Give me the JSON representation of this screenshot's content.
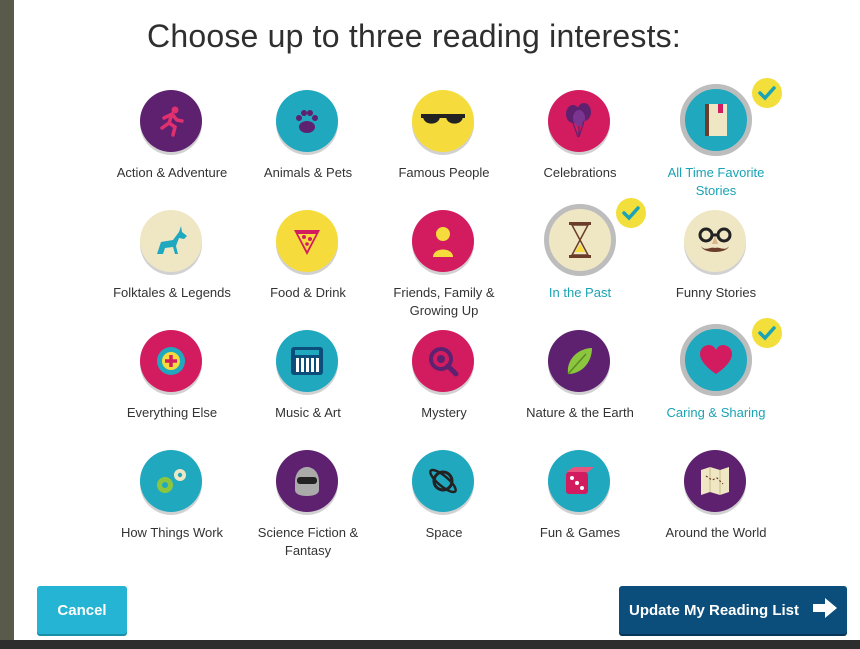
{
  "title": "Choose up to three reading interests:",
  "colors": {
    "purple": "#5e2170",
    "teal": "#20a8bf",
    "yellow": "#f5dc3c",
    "magenta": "#d31c60",
    "beige": "#efe7c4",
    "selected_text": "#1aa3b4",
    "check_badge": "#f3df3c"
  },
  "interests": [
    {
      "label": "Action & Adventure",
      "icon": "runner-icon",
      "color": "#5e2170",
      "selected": false
    },
    {
      "label": "Animals & Pets",
      "icon": "paw-icon",
      "color": "#20a8bf",
      "selected": false
    },
    {
      "label": "Famous People",
      "icon": "sunglasses-icon",
      "color": "#f5dc3c",
      "selected": false
    },
    {
      "label": "Celebrations",
      "icon": "balloons-icon",
      "color": "#d31c60",
      "selected": false
    },
    {
      "label": "All Time Favorite Stories",
      "icon": "book-icon",
      "color": "#20a8bf",
      "selected": true
    },
    {
      "label": "Folktales & Legends",
      "icon": "unicorn-icon",
      "color": "#efe7c4",
      "selected": false
    },
    {
      "label": "Food & Drink",
      "icon": "pizza-icon",
      "color": "#f5dc3c",
      "selected": false
    },
    {
      "label": "Friends, Family & Growing Up",
      "icon": "child-icon",
      "color": "#d31c60",
      "selected": false
    },
    {
      "label": "In the Past",
      "icon": "hourglass-icon",
      "color": "#efe7c4",
      "selected": true
    },
    {
      "label": "Funny Stories",
      "icon": "disguise-glasses-icon",
      "color": "#efe7c4",
      "selected": false
    },
    {
      "label": "Everything Else",
      "icon": "plus-target-icon",
      "color": "#d31c60",
      "selected": false
    },
    {
      "label": "Music & Art",
      "icon": "keyboard-icon",
      "color": "#20a8bf",
      "selected": false
    },
    {
      "label": "Mystery",
      "icon": "magnifier-icon",
      "color": "#d31c60",
      "selected": false
    },
    {
      "label": "Nature & the Earth",
      "icon": "leaf-icon",
      "color": "#5e2170",
      "selected": false
    },
    {
      "label": "Caring & Sharing",
      "icon": "heart-icon",
      "color": "#20a8bf",
      "selected": true
    },
    {
      "label": "How Things Work",
      "icon": "gears-icon",
      "color": "#20a8bf",
      "selected": false
    },
    {
      "label": "Science Fiction & Fantasy",
      "icon": "robot-helmet-icon",
      "color": "#5e2170",
      "selected": false
    },
    {
      "label": "Space",
      "icon": "planet-icon",
      "color": "#20a8bf",
      "selected": false
    },
    {
      "label": "Fun & Games",
      "icon": "dice-icon",
      "color": "#20a8bf",
      "selected": false
    },
    {
      "label": "Around the World",
      "icon": "map-icon",
      "color": "#5e2170",
      "selected": false
    }
  ],
  "buttons": {
    "cancel": "Cancel",
    "update": "Update My Reading List"
  }
}
